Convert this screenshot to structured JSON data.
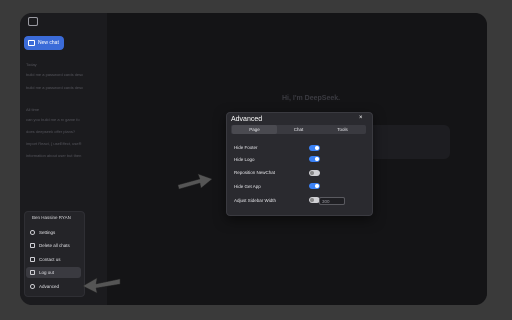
{
  "sidebar": {
    "new_chat_label": "New chat",
    "sections": [
      {
        "label": "Today",
        "chats": [
          "build me a password cards desc",
          "build me a password cards desc"
        ]
      },
      {
        "label": "All time",
        "chats": [
          "can you build me a rv game fo",
          "does deepseek offer plans?",
          "import React, { useEffect, useR",
          "information about user but then"
        ]
      }
    ]
  },
  "brand_text": "Hi, I'm DeepSeek.",
  "user_menu": {
    "user_name": "Ben Hassine RYAN",
    "items": [
      {
        "label": "Settings",
        "icon": "gear-icon"
      },
      {
        "label": "Delete all chats",
        "icon": "trash-icon"
      },
      {
        "label": "Contact us",
        "icon": "send-icon"
      },
      {
        "label": "Log out",
        "icon": "logout-icon"
      },
      {
        "label": "Advanced",
        "icon": "plus-icon"
      }
    ]
  },
  "modal": {
    "title": "Advanced",
    "close_label": "×",
    "tabs": [
      "Page",
      "Chat",
      "Tools"
    ],
    "active_tab": "Page",
    "settings": [
      {
        "label": "Hide Footer",
        "on": true
      },
      {
        "label": "Hide Logo",
        "on": true
      },
      {
        "label": "Reposition NewChat",
        "on": false
      },
      {
        "label": "Hide Get App",
        "on": true
      },
      {
        "label": "Adjust Sidebar Width",
        "on": false,
        "value": "300"
      }
    ]
  },
  "colors": {
    "accent": "#3b82f6",
    "new_chat_bg": "#3b6bd8",
    "backdrop": "#3a3a3a"
  }
}
